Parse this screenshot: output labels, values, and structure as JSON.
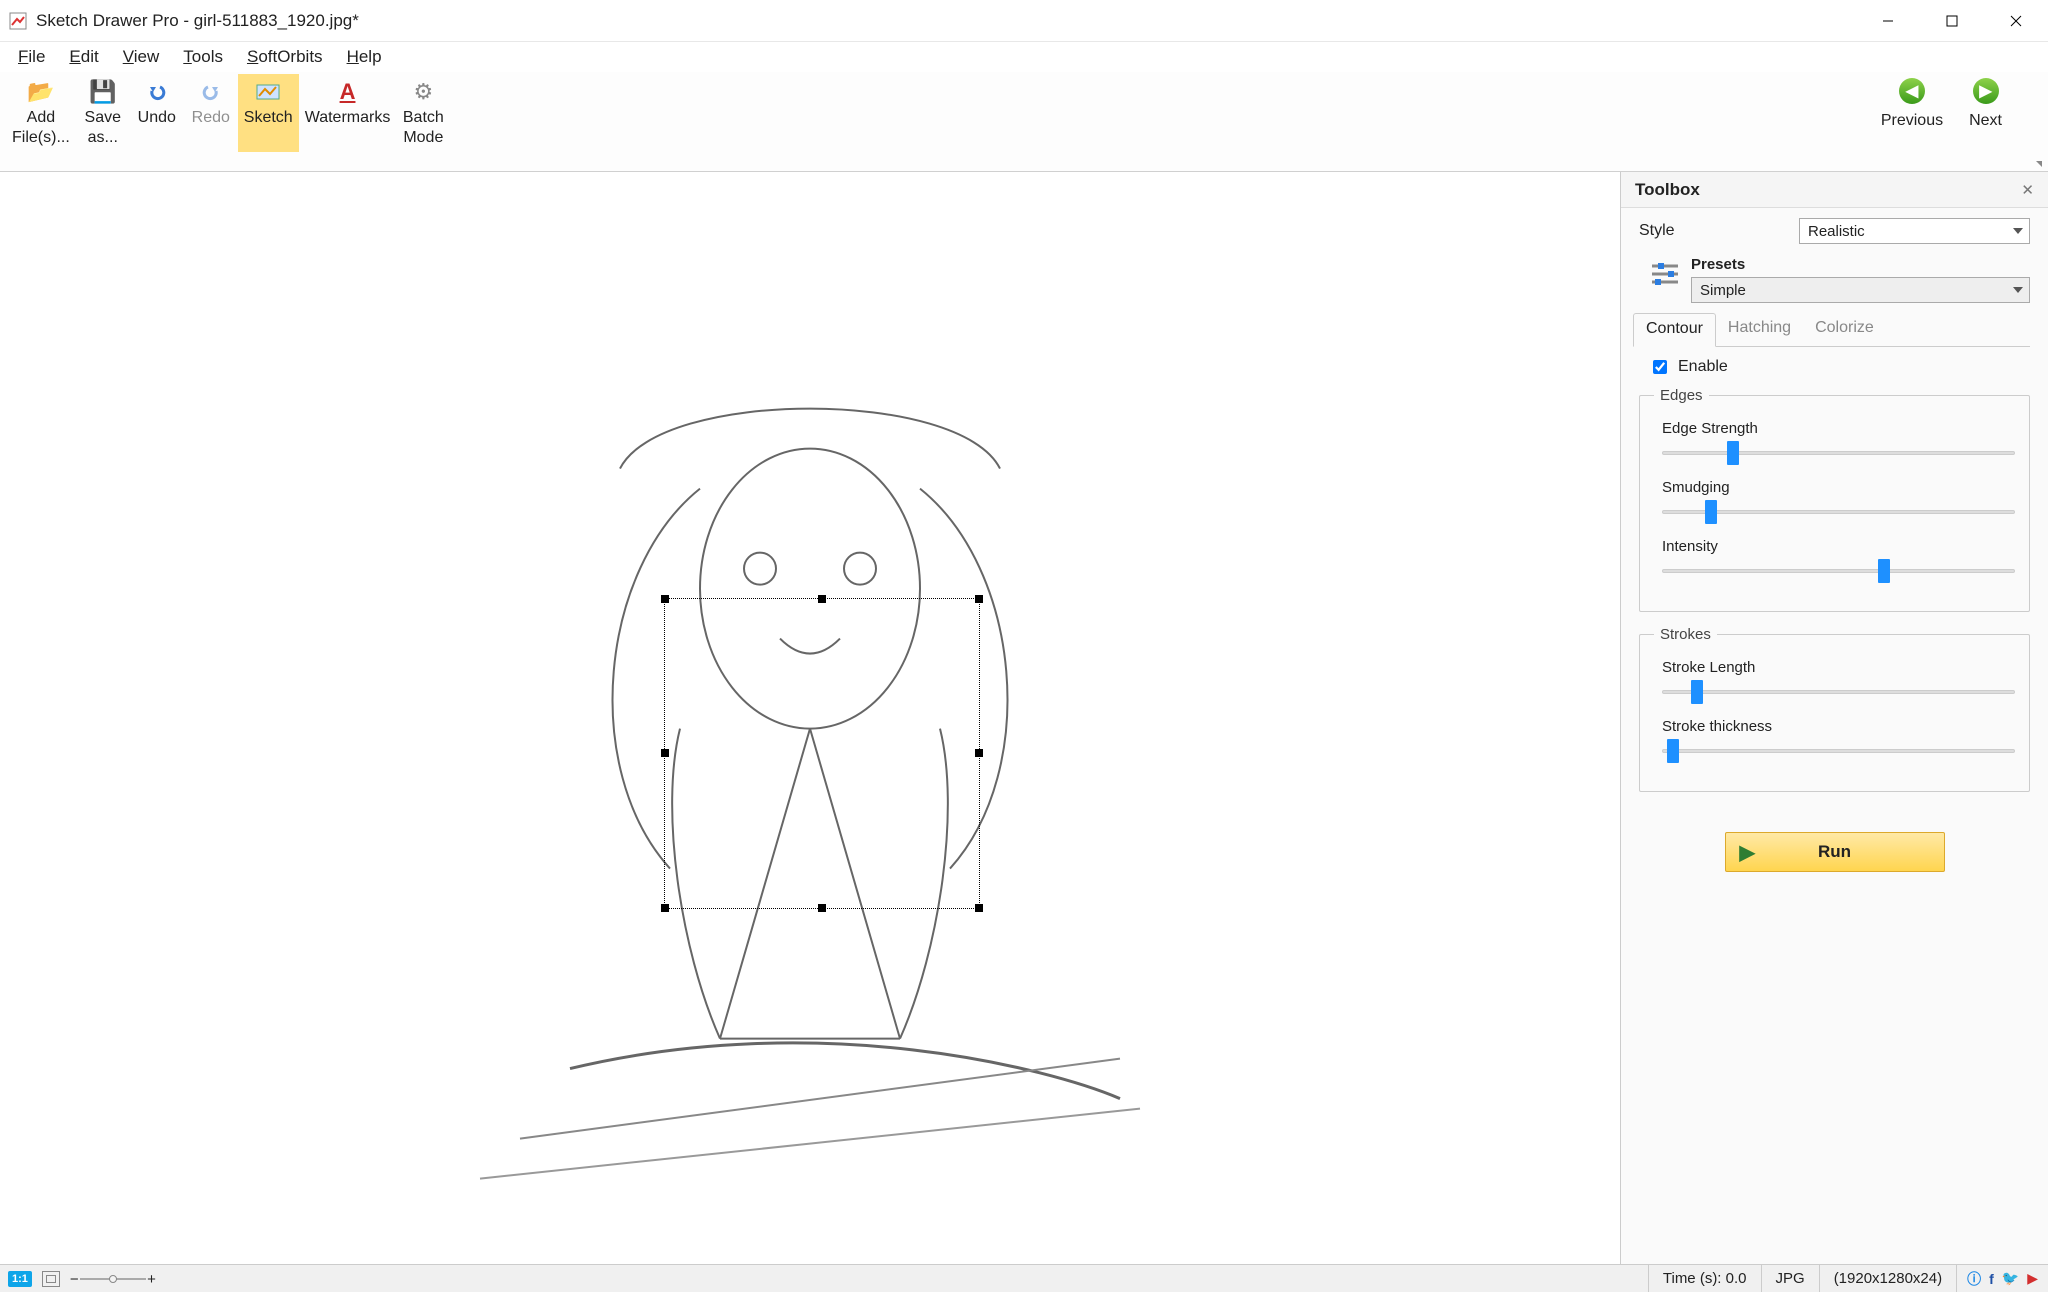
{
  "title": "Sketch Drawer Pro - girl-511883_1920.jpg*",
  "menu": [
    "File",
    "Edit",
    "View",
    "Tools",
    "SoftOrbits",
    "Help"
  ],
  "toolbar": {
    "add": "Add\nFile(s)...",
    "save": "Save\nas...",
    "undo": "Undo",
    "redo": "Redo",
    "sketch": "Sketch",
    "wm": "Watermarks",
    "batch": "Batch\nMode",
    "prev": "Previous",
    "next": "Next"
  },
  "toolbox": {
    "title": "Toolbox",
    "style_label": "Style",
    "style_value": "Realistic",
    "presets_label": "Presets",
    "presets_value": "Simple",
    "tabs": {
      "contour": "Contour",
      "hatching": "Hatching",
      "colorize": "Colorize"
    },
    "enable": "Enable",
    "edges": {
      "legend": "Edges",
      "edge_strength": "Edge Strength",
      "edge_strength_pct": 20,
      "smudging": "Smudging",
      "smudging_pct": 14,
      "intensity": "Intensity",
      "intensity_pct": 63
    },
    "strokes": {
      "legend": "Strokes",
      "stroke_length": "Stroke Length",
      "stroke_length_pct": 10,
      "stroke_thickness": "Stroke thickness",
      "stroke_thickness_pct": 3
    },
    "run": "Run"
  },
  "selection": {
    "left_pct": 41.0,
    "top_pct": 39.0,
    "width_pct": 19.5,
    "height_pct": 28.5
  },
  "status": {
    "zoom_label": "1:1",
    "time": "Time (s): 0.0",
    "format": "JPG",
    "dimensions": "(1920x1280x24)"
  }
}
